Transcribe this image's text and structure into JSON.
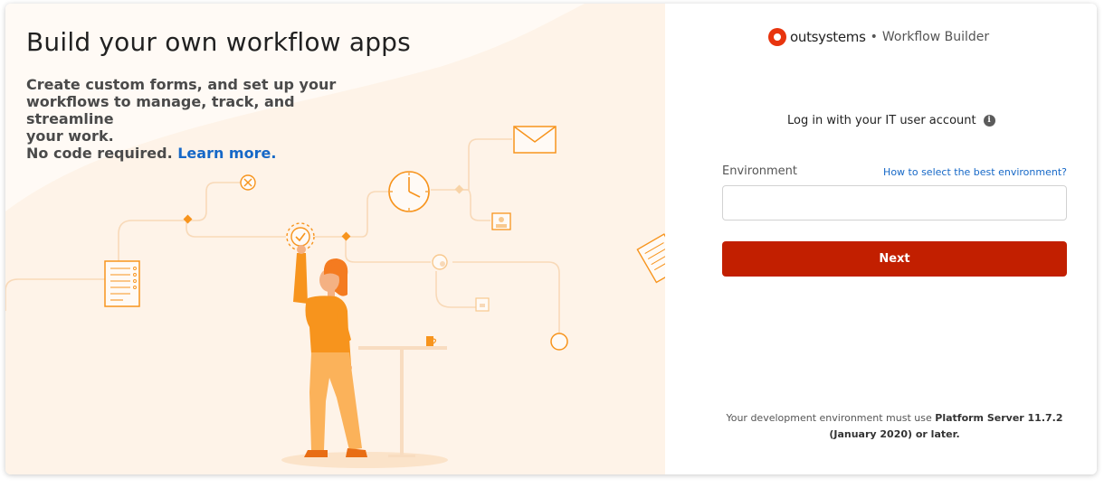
{
  "hero": {
    "title": "Build your own workflow apps",
    "subtitle_lines": [
      "Create custom forms, and set up your",
      "workflows to manage, track, and streamline",
      "your work."
    ],
    "no_code_text": "No code required. ",
    "learn_more_label": "Learn more."
  },
  "brand": {
    "name": "outsystems",
    "separator": "•",
    "product": "Workflow Builder",
    "logo_color": "#e8340e"
  },
  "login": {
    "heading": "Log in with your IT user account",
    "info_icon": "info-icon",
    "environment_label": "Environment",
    "help_link": "How to select the best environment?",
    "environment_value": "",
    "environment_placeholder": "",
    "next_label": "Next",
    "next_color": "#c21f00"
  },
  "footnote": {
    "prefix": "Your development environment must use ",
    "bold_part1": "Platform Server 11.7.2",
    "bold_part2": "(January 2020) or later."
  },
  "colors": {
    "illustration_bg": "#fffaf5",
    "accent_orange": "#f7941d",
    "link_blue": "#1668c7"
  }
}
